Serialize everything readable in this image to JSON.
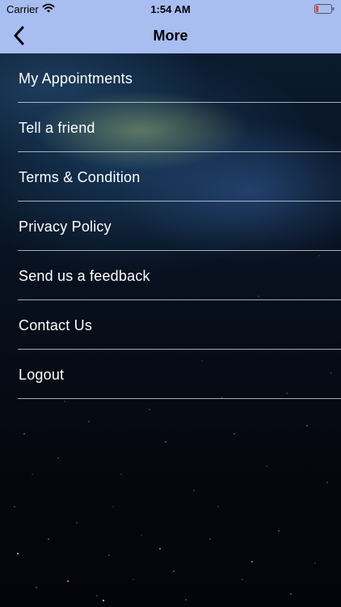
{
  "status_bar": {
    "carrier": "Carrier",
    "time": "1:54 AM"
  },
  "nav": {
    "title": "More",
    "back_icon": "chevron-left-icon"
  },
  "menu": {
    "items": [
      {
        "label": "My Appointments"
      },
      {
        "label": "Tell a friend"
      },
      {
        "label": "Terms & Condition"
      },
      {
        "label": "Privacy Policy"
      },
      {
        "label": "Send us a feedback"
      },
      {
        "label": "Contact Us"
      },
      {
        "label": "Logout"
      }
    ]
  },
  "colors": {
    "nav_background": "#a8bdf0",
    "text": "#ffffff",
    "battery_low": "#e0443a"
  }
}
